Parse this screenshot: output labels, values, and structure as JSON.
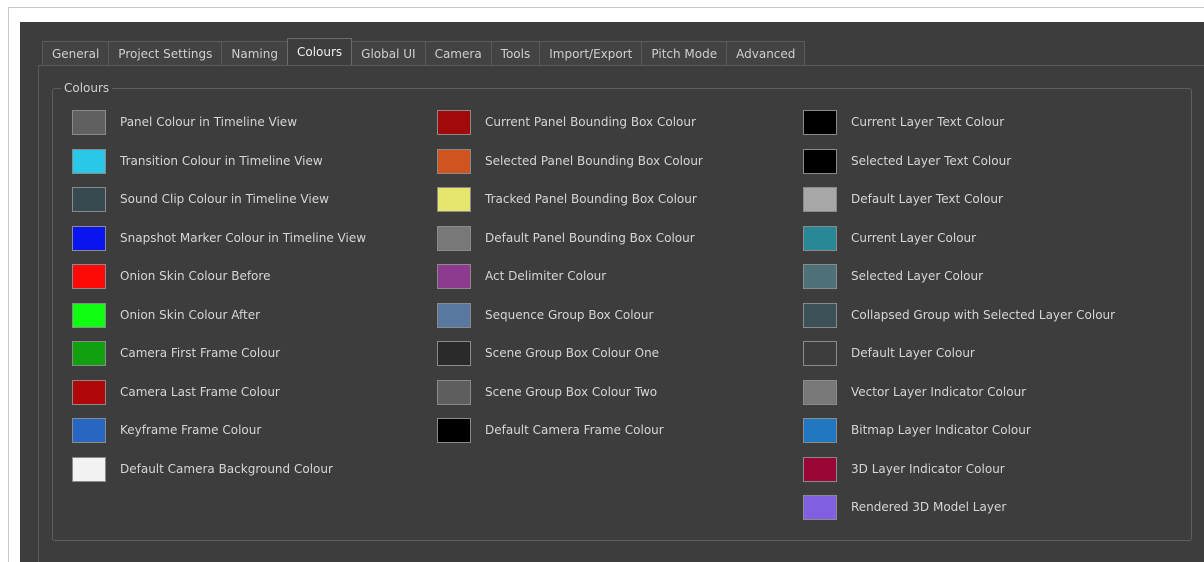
{
  "tabs": [
    {
      "label": "General",
      "active": false
    },
    {
      "label": "Project Settings",
      "active": false
    },
    {
      "label": "Naming",
      "active": false
    },
    {
      "label": "Colours",
      "active": true
    },
    {
      "label": "Global UI",
      "active": false
    },
    {
      "label": "Camera",
      "active": false
    },
    {
      "label": "Tools",
      "active": false
    },
    {
      "label": "Import/Export",
      "active": false
    },
    {
      "label": "Pitch Mode",
      "active": false
    },
    {
      "label": "Advanced",
      "active": false
    }
  ],
  "group": {
    "title": "Colours"
  },
  "columns": [
    [
      {
        "label": "Panel Colour in Timeline View",
        "color": "#606060"
      },
      {
        "label": "Transition Colour in Timeline View",
        "color": "#28c8e6"
      },
      {
        "label": "Sound Clip Colour in Timeline View",
        "color": "#364a50"
      },
      {
        "label": "Snapshot Marker Colour in Timeline View",
        "color": "#0a14ef"
      },
      {
        "label": "Onion Skin Colour Before",
        "color": "#ff0808"
      },
      {
        "label": "Onion Skin Colour After",
        "color": "#10ff10"
      },
      {
        "label": "Camera First Frame Colour",
        "color": "#10a010"
      },
      {
        "label": "Camera Last Frame Colour",
        "color": "#b00808"
      },
      {
        "label": "Keyframe Frame Colour",
        "color": "#2866c4"
      },
      {
        "label": "Default Camera Background Colour",
        "color": "#f2f2f2"
      }
    ],
    [
      {
        "label": "Current Panel Bounding Box Colour",
        "color": "#a00a0a"
      },
      {
        "label": "Selected Panel Bounding Box Colour",
        "color": "#d05420"
      },
      {
        "label": "Tracked Panel Bounding Box Colour",
        "color": "#e6e66c"
      },
      {
        "label": "Default Panel Bounding Box Colour",
        "color": "#787878"
      },
      {
        "label": "Act Delimiter Colour",
        "color": "#8e3a8e"
      },
      {
        "label": "Sequence Group Box Colour",
        "color": "#5878a0"
      },
      {
        "label": "Scene Group Box Colour One",
        "color": "#2a2a2a"
      },
      {
        "label": "Scene Group Box Colour Two",
        "color": "#5e5e5e"
      },
      {
        "label": "Default Camera Frame Colour",
        "color": "#000000"
      }
    ],
    [
      {
        "label": "Current Layer Text Colour",
        "color": "#000000"
      },
      {
        "label": "Selected Layer Text Colour",
        "color": "#000000"
      },
      {
        "label": "Default Layer Text Colour",
        "color": "#a8a8a8"
      },
      {
        "label": "Current Layer Colour",
        "color": "#288898"
      },
      {
        "label": "Selected Layer Colour",
        "color": "#4e7078"
      },
      {
        "label": "Collapsed Group with Selected Layer Colour",
        "color": "#3c5058"
      },
      {
        "label": "Default Layer Colour",
        "color": "#3d3d3d"
      },
      {
        "label": "Vector Layer Indicator Colour",
        "color": "#787878"
      },
      {
        "label": "Bitmap Layer Indicator Colour",
        "color": "#2078c0"
      },
      {
        "label": "3D Layer Indicator Colour",
        "color": "#9a0636"
      },
      {
        "label": "Rendered 3D Model Layer",
        "color": "#8060e0"
      }
    ]
  ]
}
